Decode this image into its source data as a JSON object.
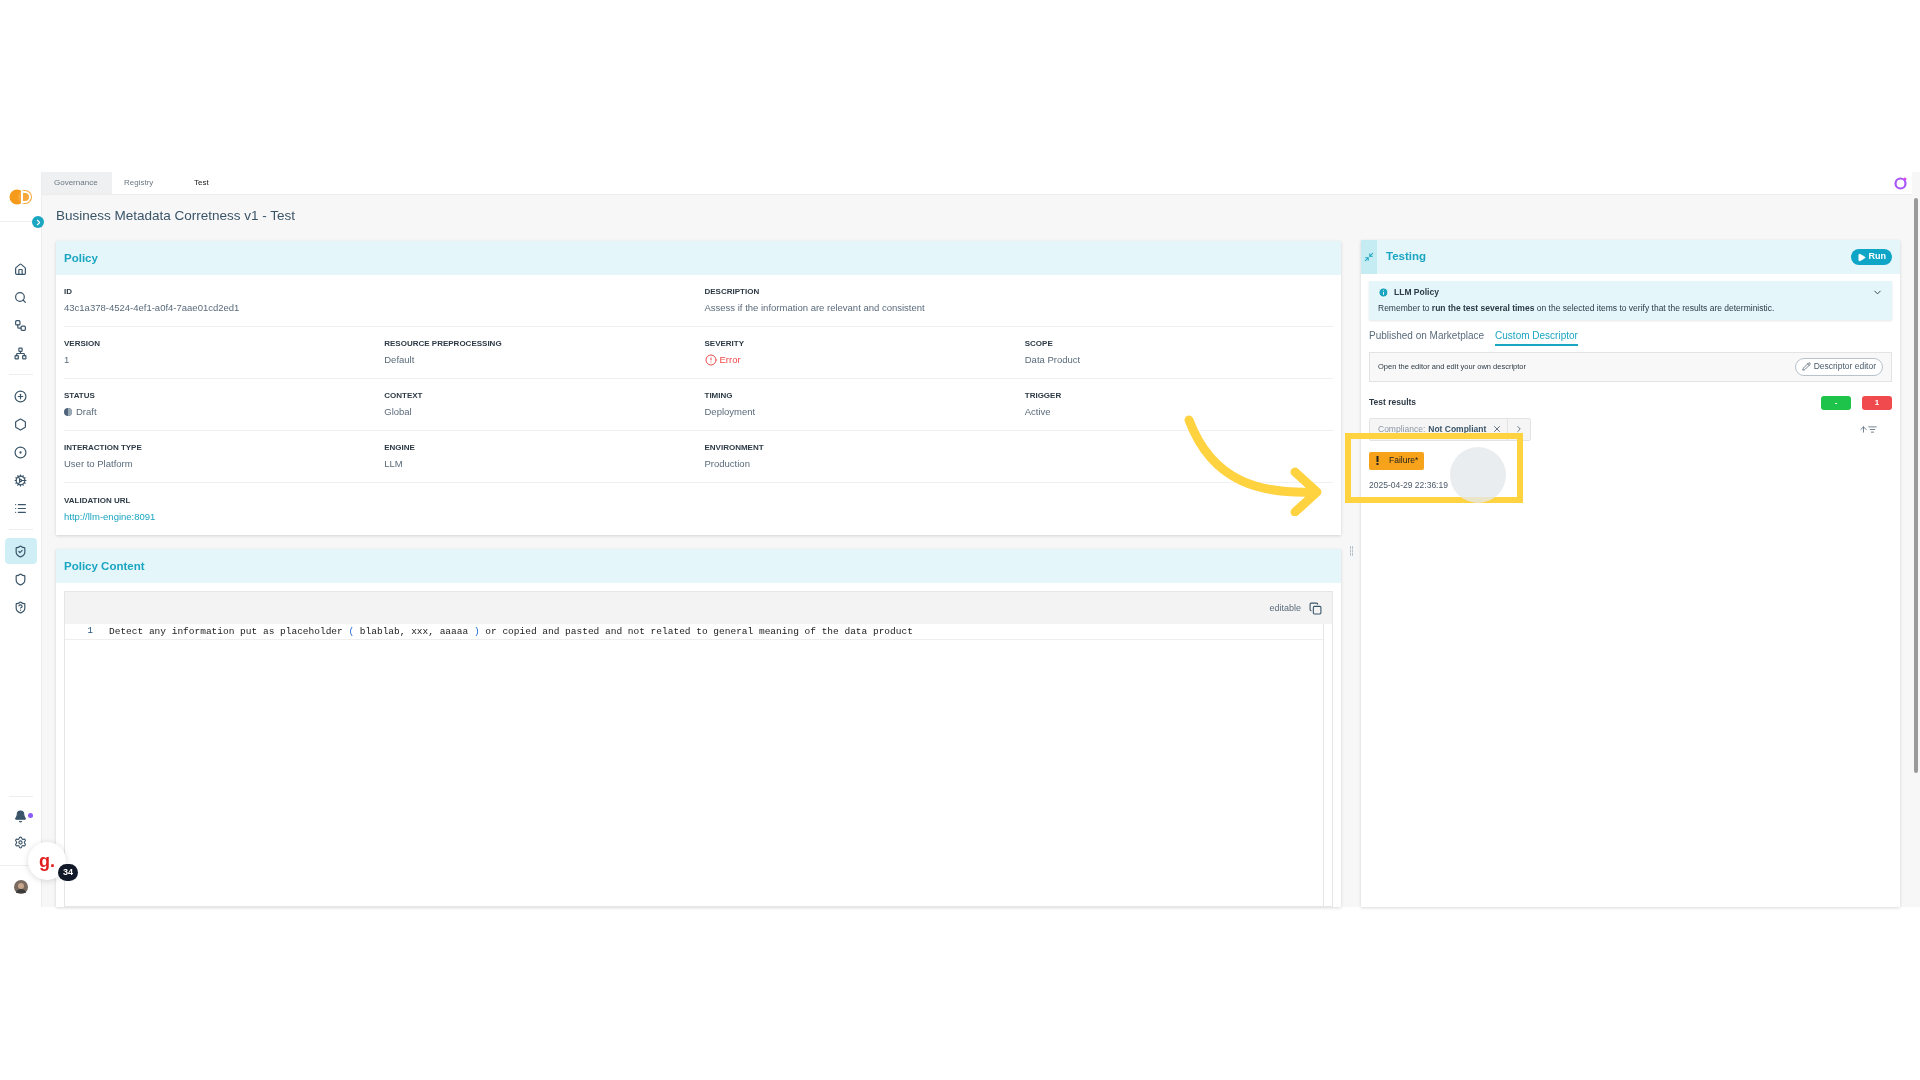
{
  "breadcrumb": [
    {
      "label": "Governance",
      "selected": false
    },
    {
      "label": "Registry",
      "selected": false
    },
    {
      "label": "Test",
      "selected": true
    }
  ],
  "sidebar": {
    "items": [
      {
        "selected": false
      },
      {
        "selected": false
      },
      {
        "selected": false
      },
      {
        "selected": false
      },
      {
        "selected": false
      },
      {
        "selected": false
      },
      {
        "selected": false
      },
      {
        "selected": false
      },
      {
        "selected": false
      },
      {
        "selected": true
      },
      {
        "selected": false
      },
      {
        "selected": false
      }
    ],
    "notifications_unread": true
  },
  "page_title": "Business Metadata Corretness v1 - Test",
  "policy": {
    "title": "Policy",
    "rows": [
      [
        {
          "label": "ID",
          "value": "43c1a378-4524-4ef1-a0f4-7aae01cd2ed1",
          "kind": "text"
        },
        null,
        {
          "label": "DESCRIPTION",
          "value": "Assess if the information are relevant and consistent",
          "kind": "text"
        }
      ],
      [
        {
          "label": "VERSION",
          "value": "1",
          "kind": "text"
        },
        {
          "label": "RESOURCE PREPROCESSING",
          "value": "Default",
          "kind": "text"
        },
        {
          "label": "SEVERITY",
          "value": "Error",
          "kind": "severity"
        },
        {
          "label": "SCOPE",
          "value": "Data Product",
          "kind": "text"
        }
      ],
      [
        {
          "label": "STATUS",
          "value": "Draft",
          "kind": "status"
        },
        {
          "label": "CONTEXT",
          "value": "Global",
          "kind": "text"
        },
        {
          "label": "TIMING",
          "value": "Deployment",
          "kind": "text"
        },
        {
          "label": "TRIGGER",
          "value": "Active",
          "kind": "text"
        }
      ],
      [
        {
          "label": "INTERACTION TYPE",
          "value": "User to Platform",
          "kind": "text"
        },
        {
          "label": "ENGINE",
          "value": "LLM",
          "kind": "text"
        },
        {
          "label": "ENVIRONMENT",
          "value": "Production",
          "kind": "text"
        }
      ],
      [
        {
          "label": "VALIDATION URL",
          "value": "http://llm-engine:8091",
          "kind": "link"
        }
      ]
    ]
  },
  "policy_content": {
    "title": "Policy Content",
    "mode": "editable",
    "lines": [
      {
        "number": "1",
        "tokens": [
          {
            "text": "Detect any information put as placeholder ",
            "kind": "plain"
          },
          {
            "text": "(",
            "kind": "bracket"
          },
          {
            "text": " blablab, xxx, aaaaa ",
            "kind": "plain"
          },
          {
            "text": ")",
            "kind": "bracket"
          },
          {
            "text": " or copied and pasted and not related to general meaning of the data product",
            "kind": "plain"
          }
        ]
      }
    ]
  },
  "testing": {
    "title": "Testing",
    "run_button": "Run",
    "alert": {
      "title": "LLM Policy",
      "text": "Remember to **run the test several times** on the selected items to verify that the results are deterministic.",
      "expanded": false
    },
    "tabs": [
      {
        "label": "Published on Marketplace",
        "selected": false
      },
      {
        "label": "Custom Descriptor",
        "selected": true
      }
    ],
    "descriptor": {
      "text": "Open the editor and edit your own descriptor",
      "button": "Descriptor editor"
    },
    "results_title": "Test results",
    "counters": [
      {
        "label": "-",
        "color": "#1ec44a"
      },
      {
        "label": "1",
        "color": "#f04a4f"
      }
    ],
    "filter": {
      "label": "Compliance:",
      "value": "Not Compliant"
    },
    "results": [
      {
        "status": "Failure*",
        "time": "2025-04-29 22:36:19"
      }
    ]
  },
  "guide_widget": {
    "logo": "g.",
    "count": "34"
  }
}
